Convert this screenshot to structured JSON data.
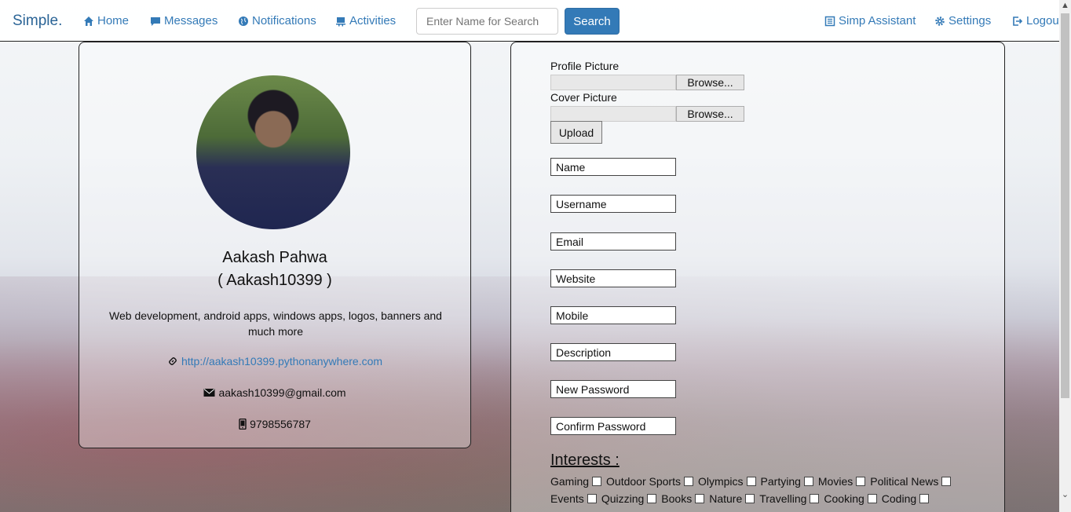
{
  "navbar": {
    "brand": "Simple.",
    "links": {
      "home": "Home",
      "messages": "Messages",
      "notifications": "Notifications",
      "activities": "Activities",
      "assistant": "Simp Assistant",
      "settings": "Settings",
      "logout": "Logout"
    },
    "search_placeholder": "Enter Name for Search",
    "search_button": "Search"
  },
  "profile": {
    "name": "Aakash Pahwa",
    "username": "( Aakash10399 )",
    "description": "Web development, android apps, windows apps, logos, banners and much more",
    "website": "http://aakash10399.pythonanywhere.com",
    "email": "aakash10399@gmail.com",
    "mobile": "9798556787"
  },
  "form": {
    "profile_picture_label": "Profile Picture",
    "cover_picture_label": "Cover Picture",
    "browse_label": "Browse...",
    "upload_label": "Upload",
    "fields": {
      "name": "Name",
      "username": "Username",
      "email": "Email",
      "website": "Website",
      "mobile": "Mobile",
      "description": "Description",
      "new_password": "New Password",
      "confirm_password": "Confirm Password"
    },
    "interests_title": "Interests :",
    "interests_row1": [
      "Gaming",
      "Outdoor Sports",
      "Olympics",
      "Partying",
      "Movies",
      "Political News"
    ],
    "interests_row2": [
      "Events",
      "Quizzing",
      "Books",
      "Nature",
      "Travelling",
      "Cooking",
      "Coding"
    ]
  },
  "colors": {
    "accent": "#337ab7",
    "brand": "#2a6496"
  }
}
